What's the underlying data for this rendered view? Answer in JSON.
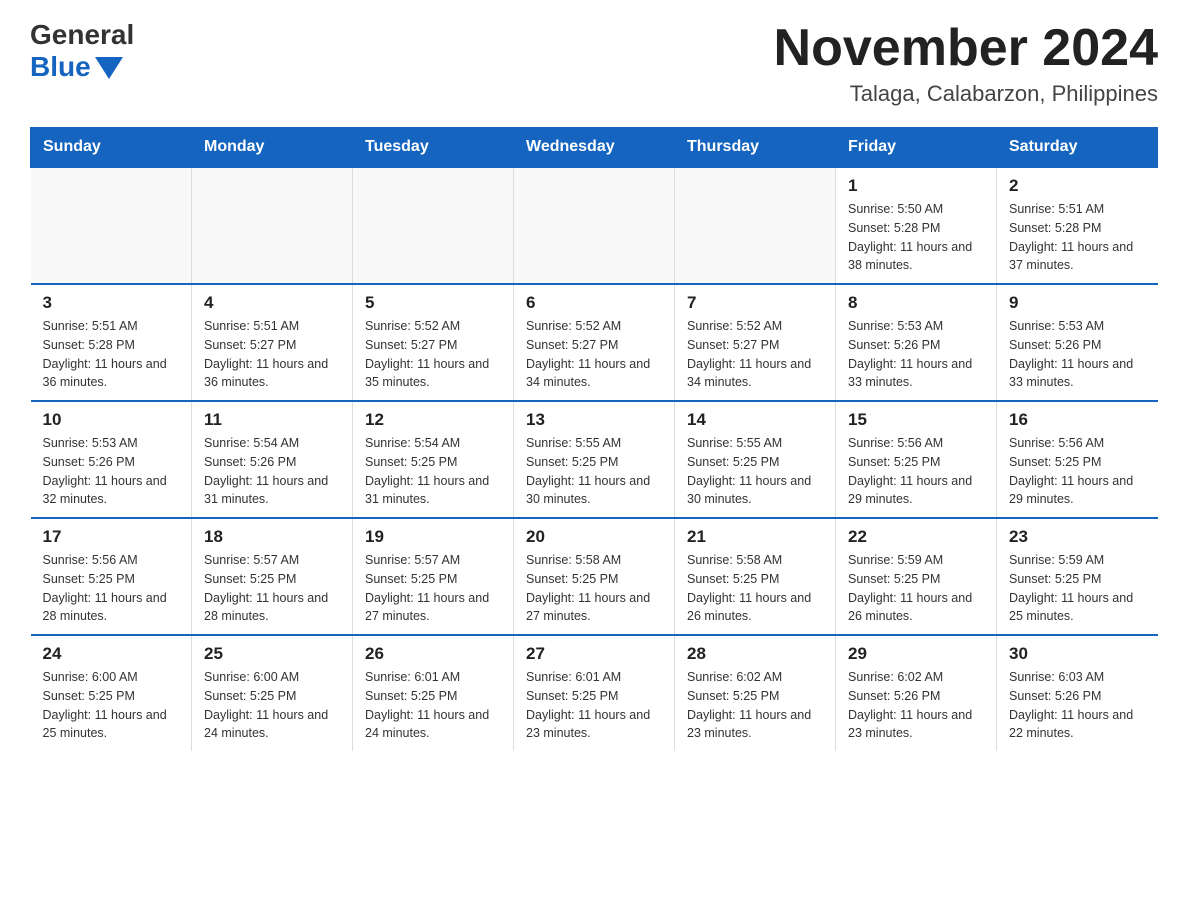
{
  "header": {
    "logo_general": "General",
    "logo_blue": "Blue",
    "month_title": "November 2024",
    "location": "Talaga, Calabarzon, Philippines"
  },
  "days_of_week": [
    "Sunday",
    "Monday",
    "Tuesday",
    "Wednesday",
    "Thursday",
    "Friday",
    "Saturday"
  ],
  "weeks": [
    [
      {
        "day": "",
        "info": ""
      },
      {
        "day": "",
        "info": ""
      },
      {
        "day": "",
        "info": ""
      },
      {
        "day": "",
        "info": ""
      },
      {
        "day": "",
        "info": ""
      },
      {
        "day": "1",
        "info": "Sunrise: 5:50 AM\nSunset: 5:28 PM\nDaylight: 11 hours and 38 minutes."
      },
      {
        "day": "2",
        "info": "Sunrise: 5:51 AM\nSunset: 5:28 PM\nDaylight: 11 hours and 37 minutes."
      }
    ],
    [
      {
        "day": "3",
        "info": "Sunrise: 5:51 AM\nSunset: 5:28 PM\nDaylight: 11 hours and 36 minutes."
      },
      {
        "day": "4",
        "info": "Sunrise: 5:51 AM\nSunset: 5:27 PM\nDaylight: 11 hours and 36 minutes."
      },
      {
        "day": "5",
        "info": "Sunrise: 5:52 AM\nSunset: 5:27 PM\nDaylight: 11 hours and 35 minutes."
      },
      {
        "day": "6",
        "info": "Sunrise: 5:52 AM\nSunset: 5:27 PM\nDaylight: 11 hours and 34 minutes."
      },
      {
        "day": "7",
        "info": "Sunrise: 5:52 AM\nSunset: 5:27 PM\nDaylight: 11 hours and 34 minutes."
      },
      {
        "day": "8",
        "info": "Sunrise: 5:53 AM\nSunset: 5:26 PM\nDaylight: 11 hours and 33 minutes."
      },
      {
        "day": "9",
        "info": "Sunrise: 5:53 AM\nSunset: 5:26 PM\nDaylight: 11 hours and 33 minutes."
      }
    ],
    [
      {
        "day": "10",
        "info": "Sunrise: 5:53 AM\nSunset: 5:26 PM\nDaylight: 11 hours and 32 minutes."
      },
      {
        "day": "11",
        "info": "Sunrise: 5:54 AM\nSunset: 5:26 PM\nDaylight: 11 hours and 31 minutes."
      },
      {
        "day": "12",
        "info": "Sunrise: 5:54 AM\nSunset: 5:25 PM\nDaylight: 11 hours and 31 minutes."
      },
      {
        "day": "13",
        "info": "Sunrise: 5:55 AM\nSunset: 5:25 PM\nDaylight: 11 hours and 30 minutes."
      },
      {
        "day": "14",
        "info": "Sunrise: 5:55 AM\nSunset: 5:25 PM\nDaylight: 11 hours and 30 minutes."
      },
      {
        "day": "15",
        "info": "Sunrise: 5:56 AM\nSunset: 5:25 PM\nDaylight: 11 hours and 29 minutes."
      },
      {
        "day": "16",
        "info": "Sunrise: 5:56 AM\nSunset: 5:25 PM\nDaylight: 11 hours and 29 minutes."
      }
    ],
    [
      {
        "day": "17",
        "info": "Sunrise: 5:56 AM\nSunset: 5:25 PM\nDaylight: 11 hours and 28 minutes."
      },
      {
        "day": "18",
        "info": "Sunrise: 5:57 AM\nSunset: 5:25 PM\nDaylight: 11 hours and 28 minutes."
      },
      {
        "day": "19",
        "info": "Sunrise: 5:57 AM\nSunset: 5:25 PM\nDaylight: 11 hours and 27 minutes."
      },
      {
        "day": "20",
        "info": "Sunrise: 5:58 AM\nSunset: 5:25 PM\nDaylight: 11 hours and 27 minutes."
      },
      {
        "day": "21",
        "info": "Sunrise: 5:58 AM\nSunset: 5:25 PM\nDaylight: 11 hours and 26 minutes."
      },
      {
        "day": "22",
        "info": "Sunrise: 5:59 AM\nSunset: 5:25 PM\nDaylight: 11 hours and 26 minutes."
      },
      {
        "day": "23",
        "info": "Sunrise: 5:59 AM\nSunset: 5:25 PM\nDaylight: 11 hours and 25 minutes."
      }
    ],
    [
      {
        "day": "24",
        "info": "Sunrise: 6:00 AM\nSunset: 5:25 PM\nDaylight: 11 hours and 25 minutes."
      },
      {
        "day": "25",
        "info": "Sunrise: 6:00 AM\nSunset: 5:25 PM\nDaylight: 11 hours and 24 minutes."
      },
      {
        "day": "26",
        "info": "Sunrise: 6:01 AM\nSunset: 5:25 PM\nDaylight: 11 hours and 24 minutes."
      },
      {
        "day": "27",
        "info": "Sunrise: 6:01 AM\nSunset: 5:25 PM\nDaylight: 11 hours and 23 minutes."
      },
      {
        "day": "28",
        "info": "Sunrise: 6:02 AM\nSunset: 5:25 PM\nDaylight: 11 hours and 23 minutes."
      },
      {
        "day": "29",
        "info": "Sunrise: 6:02 AM\nSunset: 5:26 PM\nDaylight: 11 hours and 23 minutes."
      },
      {
        "day": "30",
        "info": "Sunrise: 6:03 AM\nSunset: 5:26 PM\nDaylight: 11 hours and 22 minutes."
      }
    ]
  ]
}
